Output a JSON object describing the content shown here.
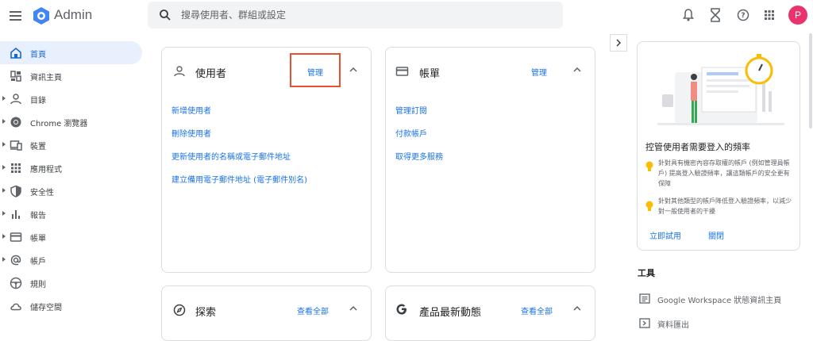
{
  "app": {
    "title": "Admin"
  },
  "search": {
    "placeholder": "搜尋使用者、群組或設定"
  },
  "account": {
    "avatar_letter": "P",
    "avatar_color": "#e8336d"
  },
  "sidebar": {
    "items": [
      {
        "label": "首頁",
        "icon": "home-icon",
        "active": true
      },
      {
        "label": "資訊主頁",
        "icon": "dashboard-icon"
      },
      {
        "label": "目錄",
        "icon": "person-icon"
      },
      {
        "label": "Chrome 瀏覽器",
        "icon": "chrome-icon"
      },
      {
        "label": "裝置",
        "icon": "devices-icon"
      },
      {
        "label": "應用程式",
        "icon": "apps-grid-icon"
      },
      {
        "label": "安全性",
        "icon": "shield-icon"
      },
      {
        "label": "報告",
        "icon": "bar-chart-icon"
      },
      {
        "label": "帳單",
        "icon": "credit-card-icon"
      },
      {
        "label": "帳戶",
        "icon": "at-icon"
      },
      {
        "label": "規則",
        "icon": "steering-icon"
      },
      {
        "label": "儲存空間",
        "icon": "cloud-icon"
      }
    ]
  },
  "cards": {
    "users": {
      "title": "使用者",
      "action": "管理",
      "links": [
        "新增使用者",
        "刪除使用者",
        "更新使用者的名稱或電子郵件地址",
        "建立備用電子郵件地址 (電子郵件別名)"
      ]
    },
    "billing": {
      "title": "帳單",
      "action": "管理",
      "links": [
        "管理訂閱",
        "付款帳戶",
        "取得更多服務"
      ]
    },
    "explore": {
      "title": "探索",
      "action": "查看全部"
    },
    "updates": {
      "title": "產品最新動態",
      "action": "查看全部"
    }
  },
  "promo": {
    "title": "控管使用者需要登入的頻率",
    "tips": [
      "針對具有機密內容存取權的帳戶 (例如管理員帳戶) 提高登入驗證頻率，讓這類帳戶的安全更有保障",
      "針對其他類型的帳戶降低登入驗證頻率，以減少對一般使用者的干擾"
    ],
    "try_label": "立即試用",
    "close_label": "關閉"
  },
  "tools": {
    "title": "工具",
    "items": [
      {
        "label": "Google Workspace 狀態資訊主頁",
        "icon": "status-dashboard-icon"
      },
      {
        "label": "資料匯出",
        "icon": "export-icon"
      }
    ]
  }
}
